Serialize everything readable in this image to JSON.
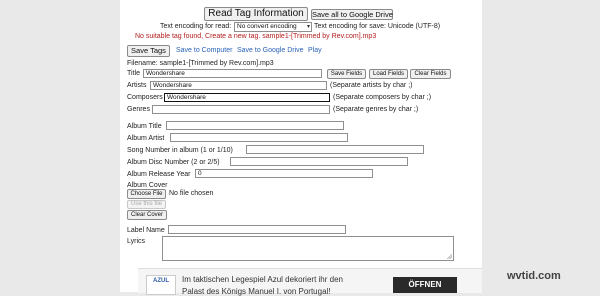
{
  "header": {
    "read_tag_button": "Read Tag Information",
    "save_all_button": "Save all to Google Drive",
    "encoding_read_label": "Text encoding for read:",
    "encoding_read_value": "No convert encoding",
    "encoding_save_label": "Text encoding for save: Unicode (UTF-8)",
    "warning": "No suitable tag found, Create a new tag. sample1-[Trimmed by Rev.com].mp3"
  },
  "actions": {
    "save_tags_button": "Save Tags",
    "save_to_computer": "Save to Computer",
    "save_to_drive": "Save to Google Drive",
    "play": "Play"
  },
  "filename_line": "Filename: sample1-[Trimmed by Rev.com].mp3",
  "fields": {
    "title": {
      "label": "Title",
      "value": "Wondershare"
    },
    "artists": {
      "label": "Artists",
      "value": "Wondershare",
      "hint": "(Separate artists by char ;)"
    },
    "composers": {
      "label": "Composers",
      "value": "Wondershare",
      "hint": "(Separate composers by char ;)"
    },
    "genres": {
      "label": "Genres",
      "value": "",
      "hint": "(Separate genres by char ;)"
    },
    "album_title": {
      "label": "Album Title",
      "value": ""
    },
    "album_artist": {
      "label": "Album Artist",
      "value": ""
    },
    "song_number": {
      "label": "Song Number in album (1 or 1/10)",
      "value": ""
    },
    "disc_number": {
      "label": "Album Disc Number (2 or 2/5)",
      "value": ""
    },
    "release_year": {
      "label": "Album Release Year",
      "value": "0"
    },
    "album_cover": {
      "label": "Album Cover"
    },
    "label_name": {
      "label": "Label Name",
      "value": ""
    },
    "lyrics": {
      "label": "Lyrics",
      "value": ""
    }
  },
  "title_buttons": {
    "save_fields": "Save Fields",
    "load_fields": "Load Fields",
    "clear_fields": "Clear Fields"
  },
  "cover": {
    "choose_file": "Choose File",
    "no_file": "No file chosen",
    "use_this_file": "Use this file",
    "clear_cover": "Clear Cover"
  },
  "ad": {
    "logo_text": "AZUL",
    "line1": "Im taktischen Legespiel Azul dekoriert ihr den",
    "line2": "Palast des Königs Manuel I. von Portugal!",
    "button": "ÖFFNEN"
  },
  "watermark": "wvtid.com",
  "colors": {
    "link": "#2a62b8",
    "warning": "#b51d1d",
    "page_bg": "#e9e9e9",
    "panel_bg": "#ffffff"
  }
}
